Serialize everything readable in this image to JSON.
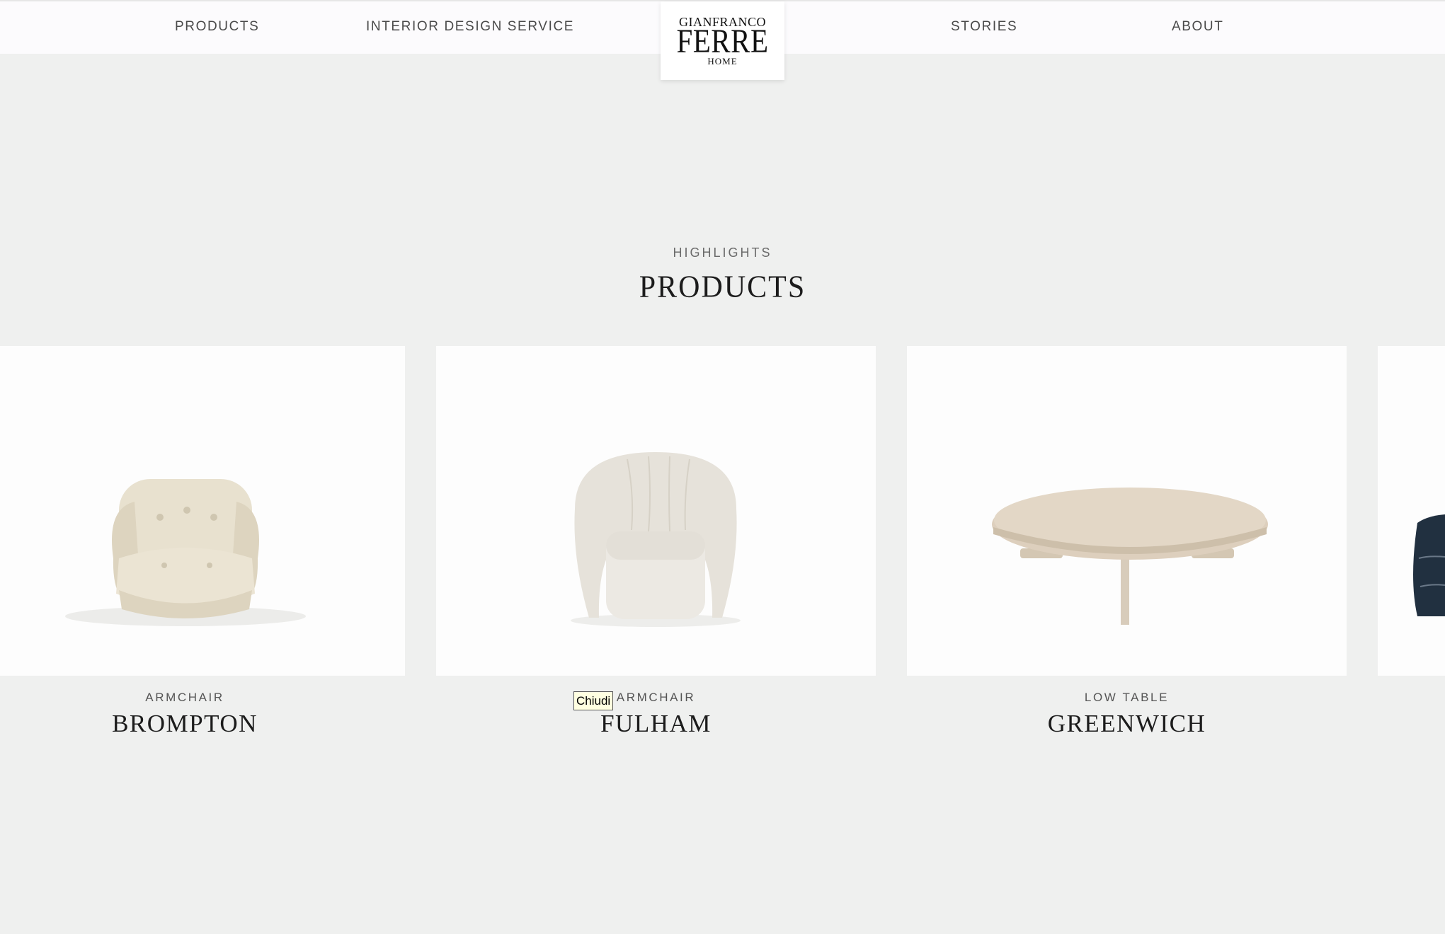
{
  "nav": {
    "items": [
      "PRODUCTS",
      "INTERIOR DESIGN SERVICE",
      "STORIES",
      "ABOUT"
    ],
    "logo": {
      "line1": "GIANFRANCO",
      "line2": "FERRE",
      "line3": "HOME"
    }
  },
  "section": {
    "eyebrow": "HIGHLIGHTS",
    "title": "PRODUCTS"
  },
  "products": [
    {
      "category": "ARMCHAIR",
      "name": "BROMPTON"
    },
    {
      "category": "ARMCHAIR",
      "name": "FULHAM"
    },
    {
      "category": "LOW TABLE",
      "name": "GREENWICH"
    }
  ],
  "tooltip": "Chiudi"
}
